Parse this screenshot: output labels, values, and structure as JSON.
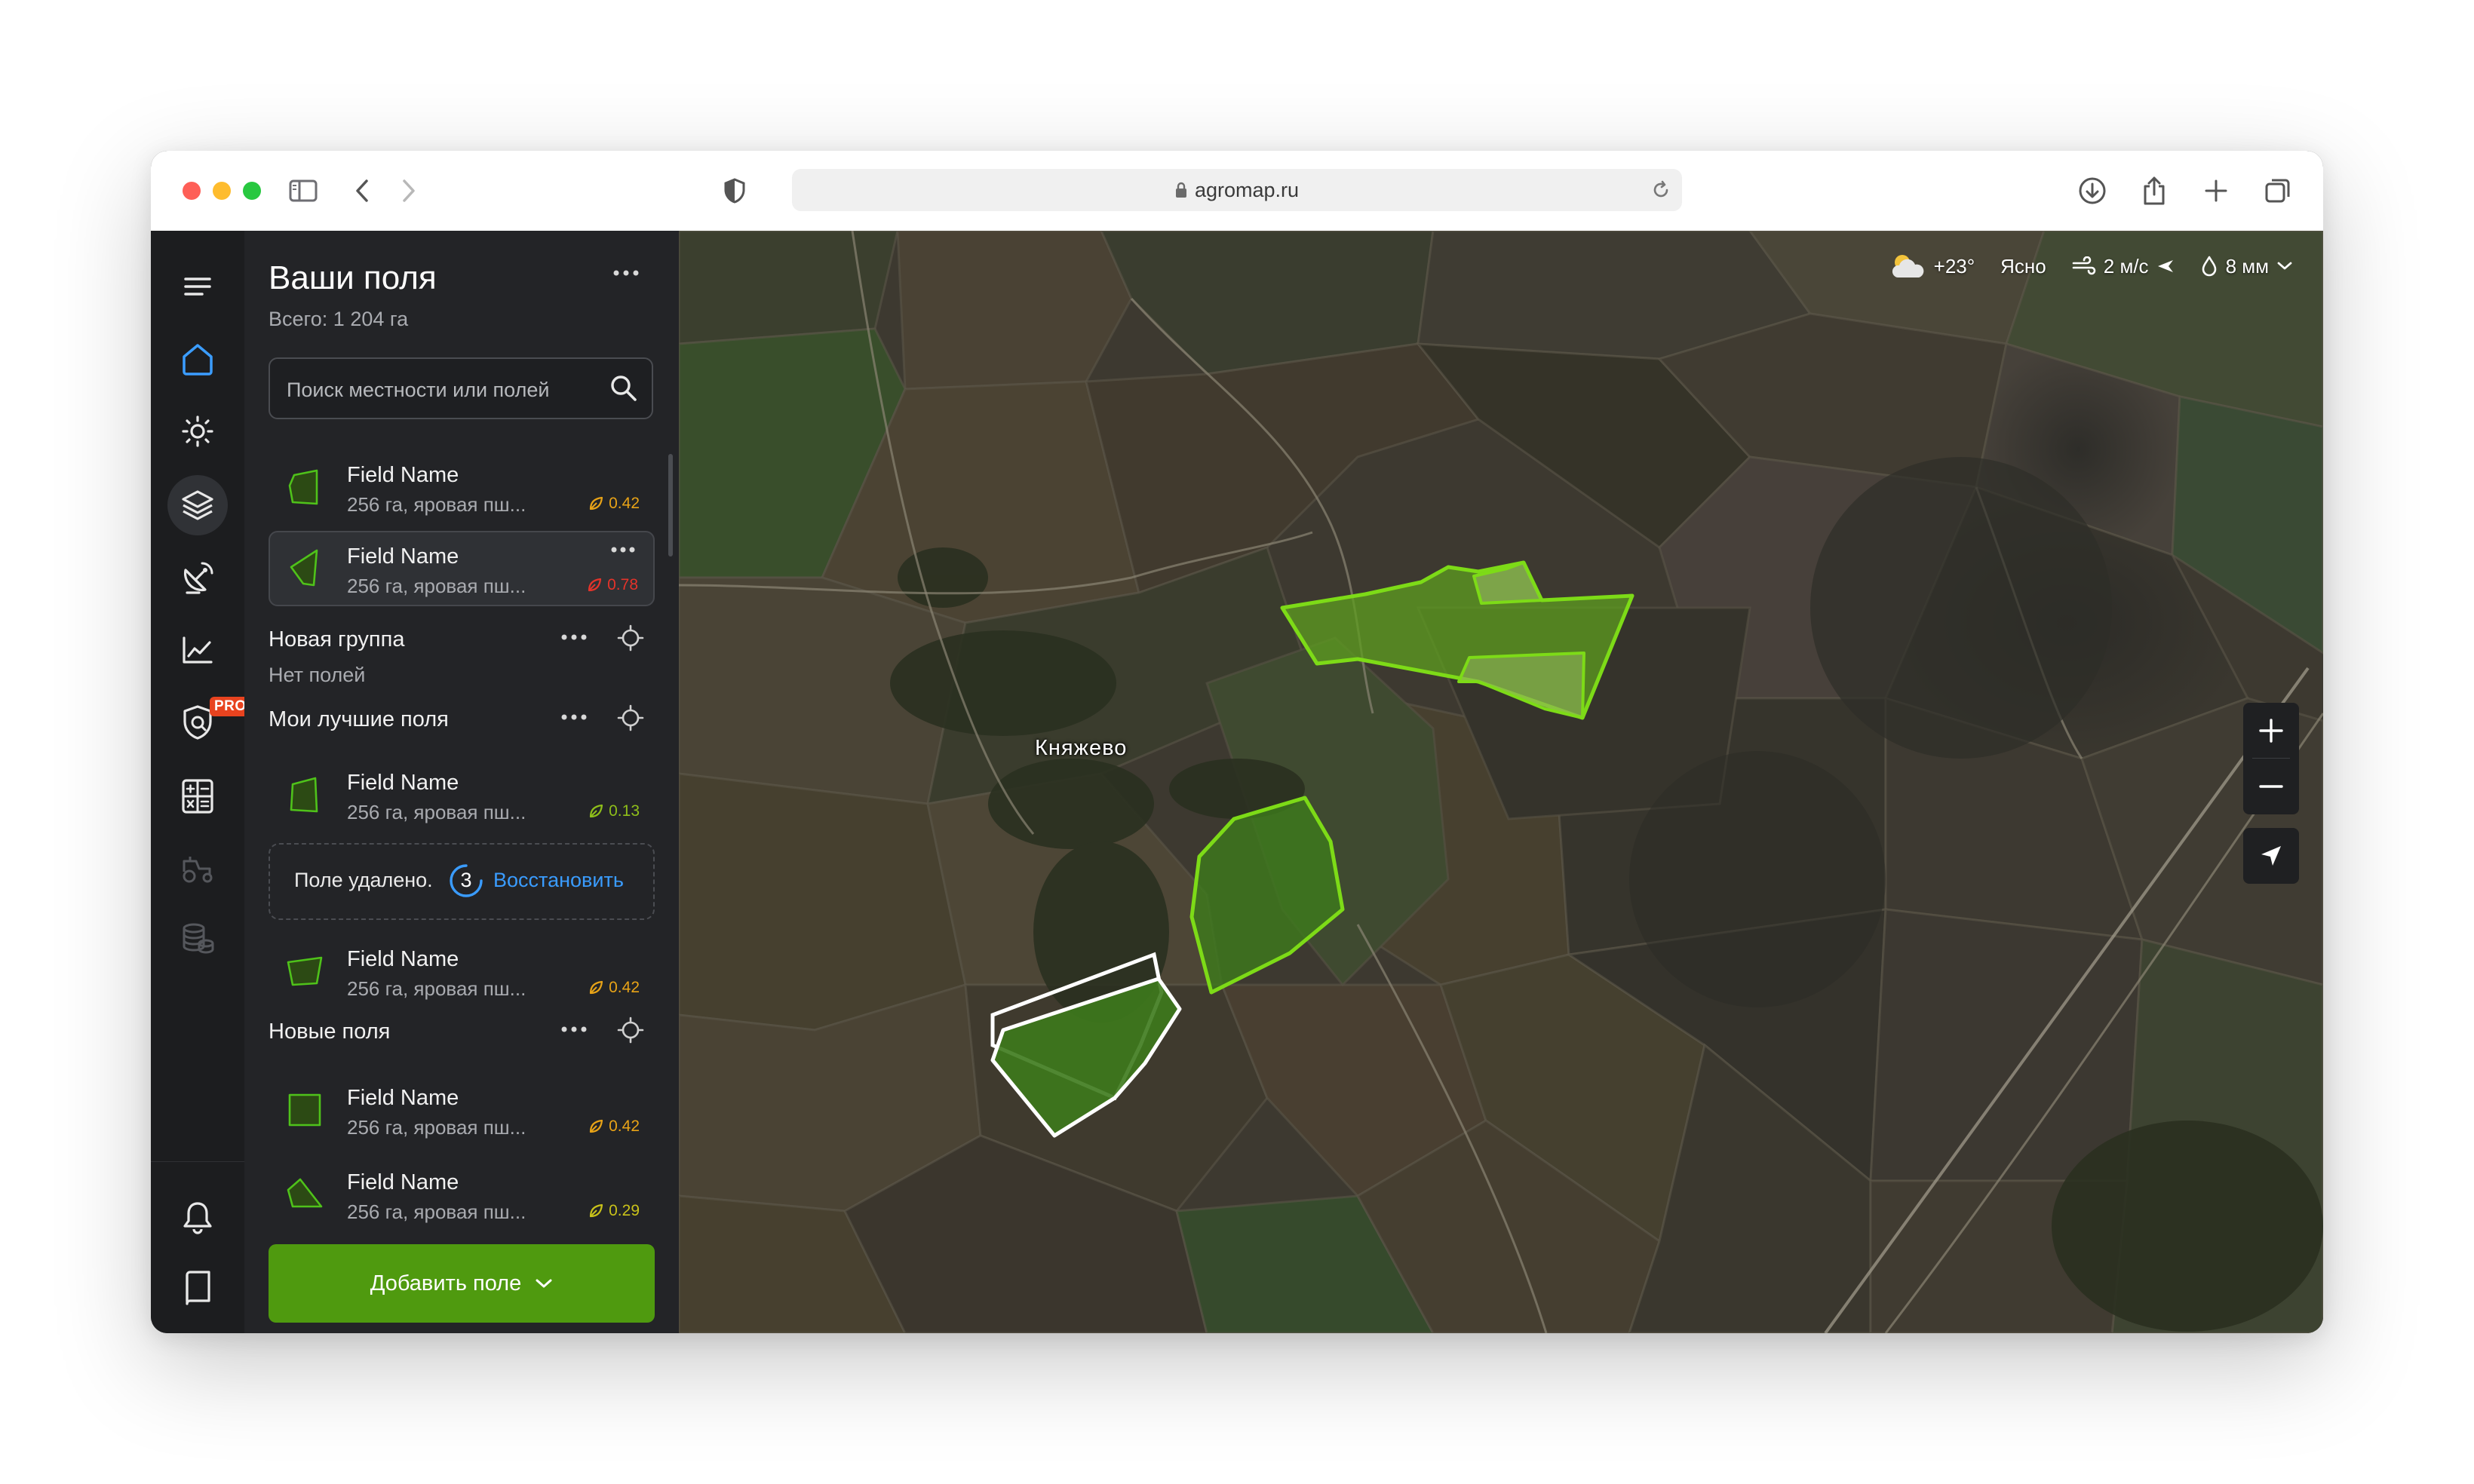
{
  "browser": {
    "url": "agromap.ru"
  },
  "sidebar_rail": {
    "icons": [
      "menu-icon",
      "home-icon",
      "sun-icon",
      "layers-icon",
      "satellite-icon",
      "analytics-icon",
      "protection-icon",
      "calculator-icon",
      "tractor-icon",
      "coins-icon",
      "bell-icon",
      "book-icon",
      "user-settings-icon",
      "upload-icon"
    ],
    "pro_badge": "PRO"
  },
  "panel": {
    "title": "Ваши поля",
    "subtitle": "Всего: 1 204 га",
    "search_placeholder": "Поиск местности или полей",
    "fields_top": [
      {
        "name": "Field Name",
        "desc": "256 га, яровая пш...",
        "ndvi": "0.42",
        "ndvi_color": "#e8a317"
      },
      {
        "name": "Field Name",
        "desc": "256 га, яровая пш...",
        "ndvi": "0.78",
        "ndvi_color": "#e5332a"
      }
    ],
    "group_new": {
      "name": "Новая группа",
      "empty_text": "Нет полей"
    },
    "group_best": {
      "name": "Мои лучшие поля",
      "fields": [
        {
          "name": "Field Name",
          "desc": "256 га, яровая пш...",
          "ndvi": "0.13",
          "ndvi_color": "#8fbf1a"
        }
      ],
      "deleted": {
        "text": "Поле удалено.",
        "countdown": "3",
        "restore_label": "Восстановить"
      },
      "fields_after": [
        {
          "name": "Field Name",
          "desc": "256 га, яровая пш...",
          "ndvi": "0.42",
          "ndvi_color": "#e8a317"
        }
      ]
    },
    "group_newfields": {
      "name": "Новые поля",
      "fields": [
        {
          "name": "Field Name",
          "desc": "256 га, яровая пш...",
          "ndvi": "0.42",
          "ndvi_color": "#e8a317"
        },
        {
          "name": "Field Name",
          "desc": "256 га, яровая пш...",
          "ndvi": "0.29",
          "ndvi_color": "#c9c21a"
        }
      ]
    },
    "add_button_label": "Добавить поле"
  },
  "map": {
    "weather": {
      "temp": "+23°",
      "condition": "Ясно",
      "wind": "2 м/с",
      "precip": "8 мм"
    },
    "village_label": "Княжево",
    "colors": {
      "field_outline": "#7ddb17",
      "selected_outline": "#ffffff",
      "accent_green": "#4f9a0f"
    }
  }
}
